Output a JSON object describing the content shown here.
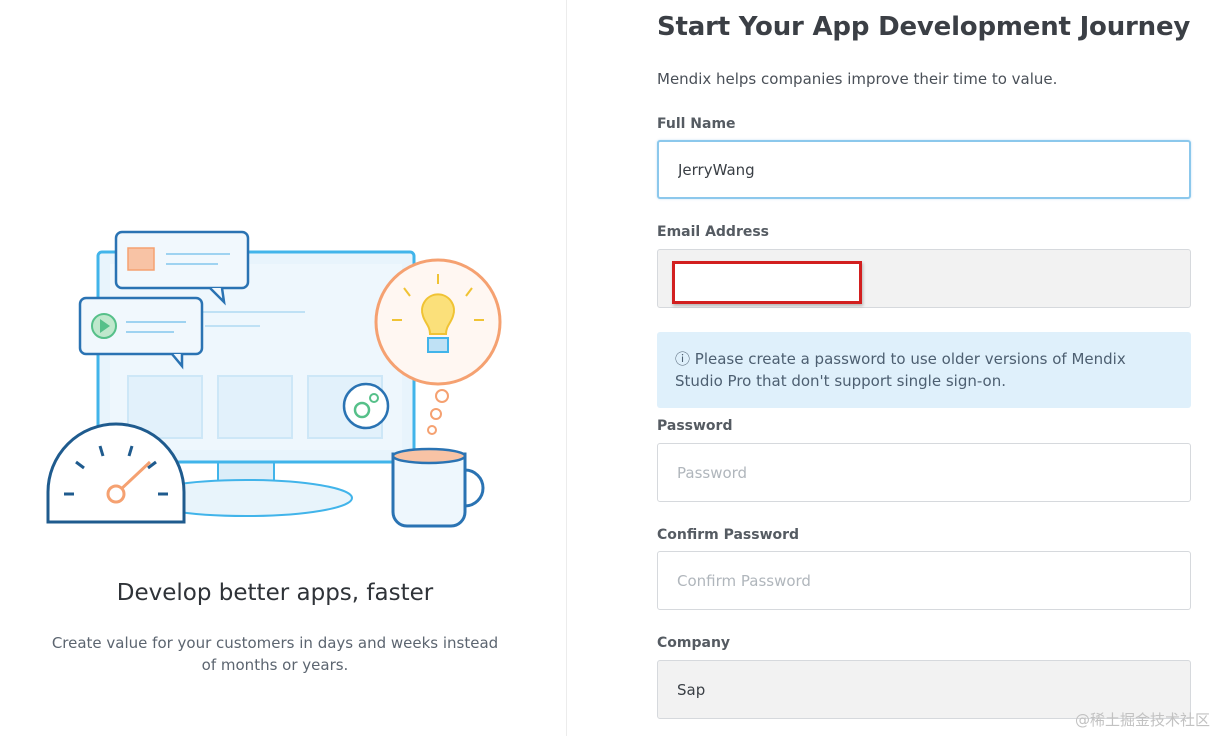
{
  "left": {
    "tagline": "Develop better apps, faster",
    "subtext": "Create value for your customers in days and weeks instead of months or years."
  },
  "form": {
    "title": "Start Your App Development Journey",
    "intro": "Mendix helps companies improve their time to value.",
    "full_name": {
      "label": "Full Name",
      "value": "JerryWang"
    },
    "email": {
      "label": "Email Address",
      "value": ""
    },
    "info": {
      "icon": "info-circle-icon",
      "text": "ⓘ Please create a password to use older versions of Mendix Studio Pro that don't support single sign-on."
    },
    "password": {
      "label": "Password",
      "placeholder": "Password"
    },
    "confirm_password": {
      "label": "Confirm Password",
      "placeholder": "Confirm Password"
    },
    "company": {
      "label": "Company",
      "value": "Sap"
    }
  },
  "watermark": "@稀土掘金技术社区",
  "colors": {
    "info_background": "#dff0fb",
    "focus_border": "#8cc8ec",
    "accent_blue": "#41b4ea",
    "accent_orange": "#f5a171",
    "navy": "#1f5b8e"
  }
}
